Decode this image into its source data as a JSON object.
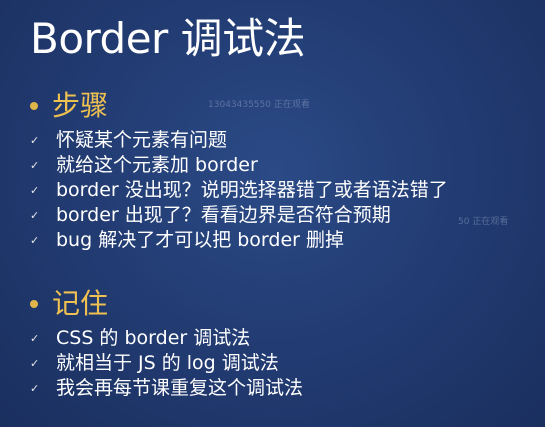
{
  "title": "Border 调试法",
  "sections": [
    {
      "title": "步骤",
      "items": [
        "怀疑某个元素有问题",
        "就给这个元素加 border",
        "border 没出现？说明选择器错了或者语法错了",
        "border 出现了？看看边界是否符合预期",
        "bug 解决了才可以把  border 删掉"
      ]
    },
    {
      "title": "记住",
      "items": [
        "CSS 的 border 调试法",
        "就相当于 JS 的 log 调试法",
        "我会再每节课重复这个调试法"
      ]
    }
  ],
  "check_icon": "check-icon",
  "watermarks": [
    "13043435550 正在观看",
    "50 正在观看"
  ],
  "colors": {
    "background": "#213a70",
    "accent": "#efc052",
    "text": "#ffffff"
  }
}
